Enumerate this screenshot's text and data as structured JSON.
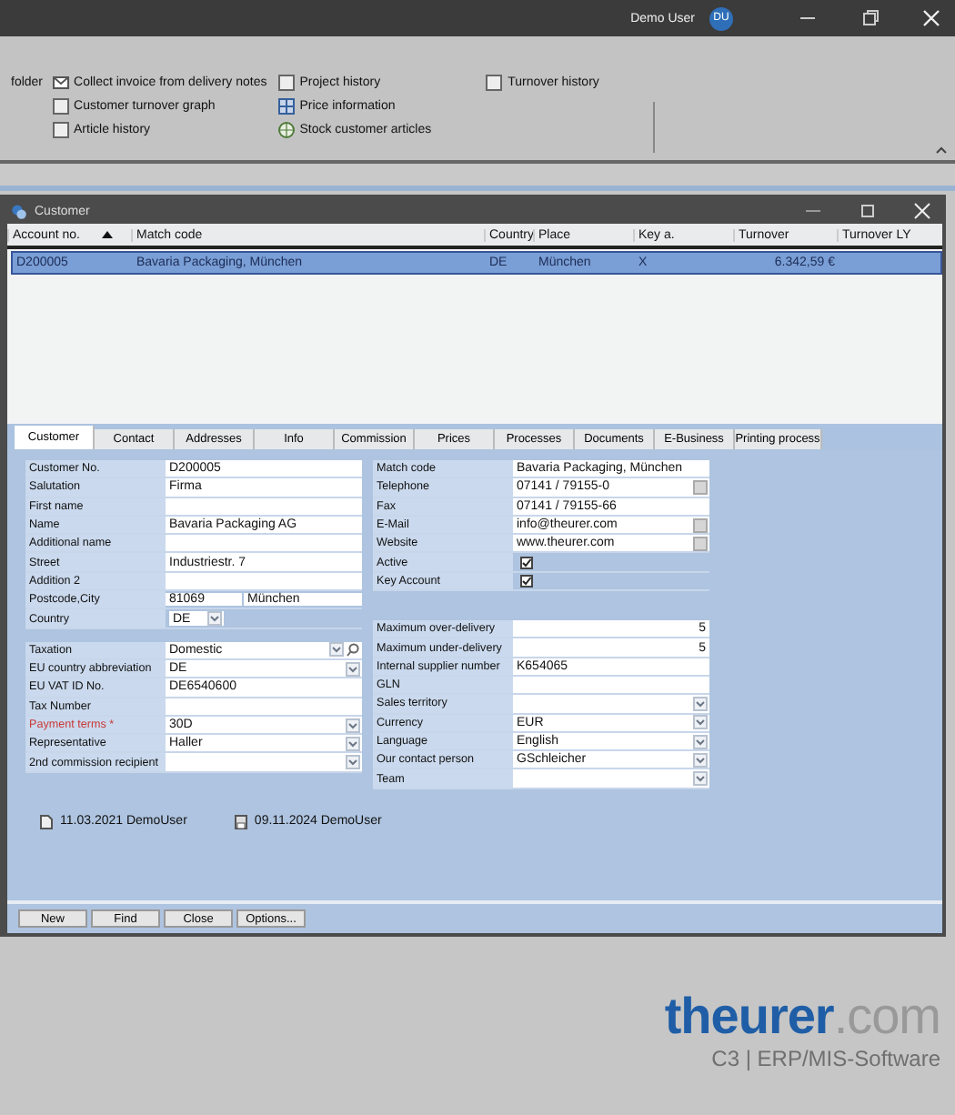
{
  "app_bar": {
    "user_name": "Demo User",
    "avatar_initials": "DU"
  },
  "ribbon": {
    "columns": [
      [
        {
          "label": "folder",
          "kind": "plain"
        }
      ],
      [
        {
          "label": "Collect invoice from delivery notes",
          "kind": "mail"
        },
        {
          "label": "Customer turnover graph",
          "kind": "toggle"
        },
        {
          "label": "Article history",
          "kind": "toggle"
        }
      ],
      [
        {
          "label": "Project history",
          "kind": "toggle"
        },
        {
          "label": "Price information",
          "kind": "table"
        },
        {
          "label": "Stock customer articles",
          "kind": "stock"
        }
      ],
      [
        {
          "label": "Turnover history",
          "kind": "toggle"
        }
      ]
    ]
  },
  "window": {
    "title": "Customer"
  },
  "table": {
    "columns": [
      {
        "label": "Account no.",
        "sorted": true
      },
      {
        "label": "Match code"
      },
      {
        "label": "Country"
      },
      {
        "label": "Place"
      },
      {
        "label": "Key a."
      },
      {
        "label": "Turnover"
      },
      {
        "label": "Turnover LY"
      }
    ],
    "rows": [
      {
        "selected": true,
        "cells": [
          "D200005",
          "Bavaria Packaging, München",
          "DE",
          "München",
          "X",
          "6.342,59 €",
          ""
        ]
      }
    ]
  },
  "tabs": [
    {
      "label": "Customer",
      "selected": true
    },
    {
      "label": "Contact",
      "selected": false
    },
    {
      "label": "Addresses",
      "selected": false
    },
    {
      "label": "Info",
      "selected": false
    },
    {
      "label": "Commission",
      "selected": false
    },
    {
      "label": "Prices",
      "selected": false
    },
    {
      "label": "Processes",
      "selected": false
    },
    {
      "label": "Documents",
      "selected": false
    },
    {
      "label": "E-Business",
      "selected": false
    },
    {
      "label": "Printing process",
      "selected": false
    }
  ],
  "form": {
    "left": [
      [
        {
          "label": "Customer No.",
          "kind": "text",
          "value": "D200005"
        },
        {
          "label": "Salutation",
          "kind": "text",
          "value": "Firma"
        },
        {
          "label": "First name",
          "kind": "text"
        },
        {
          "label": "Name",
          "kind": "text",
          "value": "Bavaria Packaging AG"
        },
        {
          "label": "Additional name",
          "kind": "text"
        },
        {
          "label": "Street",
          "kind": "text",
          "value": "Industriestr. 7"
        },
        {
          "label": "Addition 2",
          "kind": "text"
        },
        {
          "label": "Postcode,City",
          "kind": "pair",
          "values": [
            "81069",
            "München"
          ]
        },
        {
          "label": "Country",
          "kind": "short-dropdown",
          "value": "DE"
        }
      ],
      [
        {
          "label": "Taxation",
          "kind": "lookup",
          "value": "Domestic"
        },
        {
          "label": "EU country abbreviation",
          "kind": "dropdown",
          "value": "DE"
        },
        {
          "label": "EU VAT ID No.",
          "kind": "text",
          "value": "DE6540600"
        },
        {
          "label": "Tax Number",
          "kind": "text"
        },
        {
          "label": "Payment terms *",
          "kind": "dropdown",
          "value": "30D",
          "required": true
        },
        {
          "label": "Representative",
          "kind": "dropdown",
          "value": "Haller"
        },
        {
          "label": "2nd commission recipient",
          "kind": "dropdown"
        }
      ]
    ],
    "right": [
      [
        {
          "label": "Match code",
          "kind": "text",
          "value": "Bavaria Packaging, München"
        },
        {
          "label": "Telephone",
          "kind": "action",
          "value": "07141 / 79155-0"
        },
        {
          "label": "Fax",
          "kind": "text",
          "value": "07141 / 79155-66"
        },
        {
          "label": "E-Mail",
          "kind": "action",
          "value": "info@theurer.com"
        },
        {
          "label": "Website",
          "kind": "action",
          "value": "www.theurer.com"
        },
        {
          "label": "Active",
          "kind": "checkbox",
          "checked": true
        },
        {
          "label": "Key Account",
          "kind": "checkbox",
          "checked": true
        }
      ],
      [
        {
          "label": "Maximum over-delivery",
          "kind": "number",
          "value": "5"
        },
        {
          "label": "Maximum under-delivery",
          "kind": "number",
          "value": "5"
        },
        {
          "label": "Internal supplier number",
          "kind": "text",
          "value": "K654065"
        },
        {
          "label": "GLN",
          "kind": "text"
        },
        {
          "label": "Sales territory",
          "kind": "dropdown"
        },
        {
          "label": "Currency",
          "kind": "dropdown",
          "value": "EUR"
        },
        {
          "label": "Language",
          "kind": "dropdown",
          "value": "English"
        },
        {
          "label": "Our contact person",
          "kind": "dropdown",
          "value": "GSchleicher"
        },
        {
          "label": "Team",
          "kind": "dropdown"
        }
      ]
    ]
  },
  "record_info": [
    {
      "kind": "created",
      "text": "11.03.2021 DemoUser"
    },
    {
      "kind": "changed",
      "text": "09.11.2024 DemoUser"
    }
  ],
  "buttons": [
    "New",
    "Find",
    "Close",
    "Options..."
  ],
  "branding": {
    "name": "theurer",
    "domain": ".com",
    "tagline": "C3 | ERP/MIS-Software"
  }
}
